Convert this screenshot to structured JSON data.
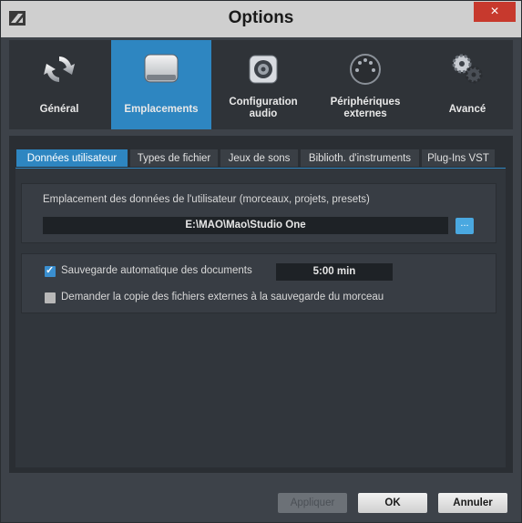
{
  "window": {
    "title": "Options",
    "close_glyph": "×"
  },
  "categories": [
    {
      "label": "Général",
      "icon": "refresh-icon",
      "active": false
    },
    {
      "label": "Emplacements",
      "icon": "drive-icon",
      "active": true
    },
    {
      "label": "Configuration audio",
      "icon": "speaker-icon",
      "active": false
    },
    {
      "label": "Périphériques externes",
      "icon": "midi-icon",
      "active": false
    },
    {
      "label": "Avancé",
      "icon": "gears-icon",
      "active": false
    }
  ],
  "tabs": [
    {
      "label": "Données utilisateur",
      "active": true
    },
    {
      "label": "Types de fichier",
      "active": false
    },
    {
      "label": "Jeux de sons",
      "active": false
    },
    {
      "label": "Biblioth. d'instruments",
      "active": false
    },
    {
      "label": "Plug-Ins VST",
      "active": false
    }
  ],
  "user_data": {
    "location_label": "Emplacement des données de l'utilisateur (morceaux, projets, presets)",
    "path_value": "E:\\MAO\\Mao\\Studio One",
    "browse_label": "...",
    "autosave_label": "Sauvegarde automatique des documents",
    "autosave_checked": true,
    "autosave_interval": "5:00 min",
    "copy_external_label": "Demander la copie des fichiers externes à la sauvegarde du morceau",
    "copy_external_checked": false
  },
  "buttons": {
    "apply": "Appliquer",
    "ok": "OK",
    "cancel": "Annuler"
  },
  "colors": {
    "accent": "#2e86c1",
    "close": "#c7392d"
  }
}
